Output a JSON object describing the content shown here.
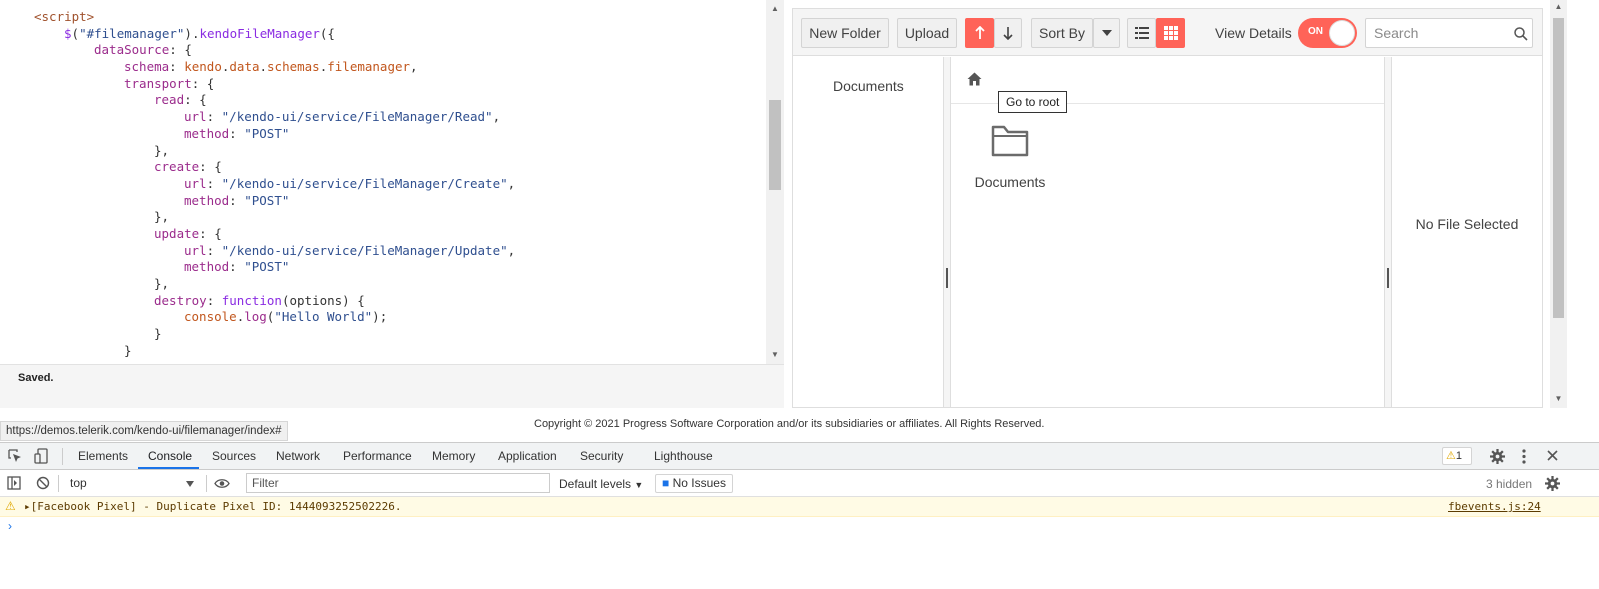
{
  "editor": {
    "lines": [
      {
        "indent": 34,
        "segments": [
          [
            "tag",
            "<script>"
          ]
        ]
      },
      {
        "indent": 64,
        "segments": [
          [
            "fn",
            "$"
          ],
          [
            "p",
            "("
          ],
          [
            "str",
            "\"#filemanager\""
          ],
          [
            "p",
            ")."
          ],
          [
            "fn",
            "kendoFileManager"
          ],
          [
            "p",
            "({"
          ]
        ]
      },
      {
        "indent": 94,
        "segments": [
          [
            "key",
            "dataSource"
          ],
          [
            "p",
            ": {"
          ]
        ]
      },
      {
        "indent": 124,
        "segments": [
          [
            "key",
            "schema"
          ],
          [
            "p",
            ": "
          ],
          [
            "obj",
            "kendo"
          ],
          [
            "p",
            "."
          ],
          [
            "obj",
            "data"
          ],
          [
            "p",
            "."
          ],
          [
            "obj",
            "schemas"
          ],
          [
            "p",
            "."
          ],
          [
            "obj",
            "filemanager"
          ],
          [
            "p",
            ","
          ]
        ]
      },
      {
        "indent": 124,
        "segments": [
          [
            "key",
            "transport"
          ],
          [
            "p",
            ": {"
          ]
        ]
      },
      {
        "indent": 154,
        "segments": [
          [
            "key",
            "read"
          ],
          [
            "p",
            ": {"
          ]
        ]
      },
      {
        "indent": 184,
        "segments": [
          [
            "key",
            "url"
          ],
          [
            "p",
            ": "
          ],
          [
            "str",
            "\"/kendo-ui/service/FileManager/Read\""
          ],
          [
            "p",
            ","
          ]
        ]
      },
      {
        "indent": 184,
        "segments": [
          [
            "key",
            "method"
          ],
          [
            "p",
            ": "
          ],
          [
            "str",
            "\"POST\""
          ]
        ]
      },
      {
        "indent": 154,
        "segments": [
          [
            "p",
            "},"
          ]
        ]
      },
      {
        "indent": 154,
        "segments": [
          [
            "key",
            "create"
          ],
          [
            "p",
            ": {"
          ]
        ]
      },
      {
        "indent": 184,
        "segments": [
          [
            "key",
            "url"
          ],
          [
            "p",
            ": "
          ],
          [
            "str",
            "\"/kendo-ui/service/FileManager/Create\""
          ],
          [
            "p",
            ","
          ]
        ]
      },
      {
        "indent": 184,
        "segments": [
          [
            "key",
            "method"
          ],
          [
            "p",
            ": "
          ],
          [
            "str",
            "\"POST\""
          ]
        ]
      },
      {
        "indent": 154,
        "segments": [
          [
            "p",
            "},"
          ]
        ]
      },
      {
        "indent": 154,
        "segments": [
          [
            "key",
            "update"
          ],
          [
            "p",
            ": {"
          ]
        ]
      },
      {
        "indent": 184,
        "segments": [
          [
            "key",
            "url"
          ],
          [
            "p",
            ": "
          ],
          [
            "str",
            "\"/kendo-ui/service/FileManager/Update\""
          ],
          [
            "p",
            ","
          ]
        ]
      },
      {
        "indent": 184,
        "segments": [
          [
            "key",
            "method"
          ],
          [
            "p",
            ": "
          ],
          [
            "str",
            "\"POST\""
          ]
        ]
      },
      {
        "indent": 154,
        "segments": [
          [
            "p",
            "},"
          ]
        ]
      },
      {
        "indent": 154,
        "segments": [
          [
            "key",
            "destroy"
          ],
          [
            "p",
            ": "
          ],
          [
            "fn",
            "function"
          ],
          [
            "p",
            "(options) {"
          ]
        ]
      },
      {
        "indent": 184,
        "segments": [
          [
            "obj",
            "console"
          ],
          [
            "p",
            "."
          ],
          [
            "key",
            "log"
          ],
          [
            "p",
            "("
          ],
          [
            "str",
            "\"Hello World\""
          ],
          [
            "p",
            ");"
          ]
        ]
      },
      {
        "indent": 154,
        "segments": [
          [
            "p",
            "}"
          ]
        ]
      },
      {
        "indent": 124,
        "segments": [
          [
            "p",
            "}"
          ]
        ]
      }
    ],
    "status": "Saved."
  },
  "filemanager": {
    "toolbar": {
      "new_folder": "New Folder",
      "upload": "Upload",
      "sort_by": "Sort By",
      "view_details": "View Details",
      "switch_label": "ON",
      "search_placeholder": "Search"
    },
    "tree": {
      "item": "Documents"
    },
    "breadcrumb": {
      "tooltip": "Go to root"
    },
    "content": {
      "folder": "Documents"
    },
    "details": {
      "empty": "No File Selected"
    }
  },
  "footer": {
    "copyright": "Copyright © 2021 Progress Software Corporation and/or its subsidiaries or affiliates. All Rights Reserved.",
    "status_url": "https://demos.telerik.com/kendo-ui/filemanager/index#"
  },
  "devtools": {
    "tabs": [
      "Elements",
      "Console",
      "Sources",
      "Network",
      "Performance",
      "Memory",
      "Application",
      "Security",
      "Lighthouse"
    ],
    "active_tab": "Console",
    "warning_count": "1",
    "context": "top",
    "filter_placeholder": "Filter",
    "levels": "Default levels",
    "issues": "No Issues",
    "hidden": "3 hidden",
    "warning_message": "▸[Facebook Pixel] - Duplicate Pixel ID: 1444093252502226.",
    "warning_source": "fbevents.js:24",
    "prompt": "›"
  },
  "colors": {
    "accent": "#ff6358",
    "devtools_blue": "#1a73e8",
    "warning_bg": "#fffbe5"
  }
}
